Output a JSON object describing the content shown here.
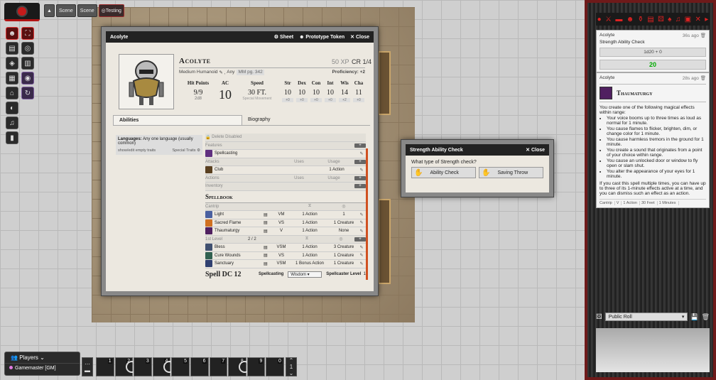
{
  "scene_nav": {
    "collapse_icon": "caret-up-icon",
    "scenes": [
      "Scene",
      "Scene",
      "Testing"
    ]
  },
  "tools": [
    "user-icon",
    "expand-icon",
    "ruler-icon",
    "target-icon",
    "shapes-icon",
    "tile-icon",
    "columns-icon",
    "eye-icon",
    "lightbulb-icon",
    "music-icon",
    "bookmark-icon"
  ],
  "sheet": {
    "title": "Acolyte",
    "header_buttons": [
      "Sheet",
      "Prototype Token",
      "Close"
    ],
    "name": "Acolyte",
    "xp": "50 XP",
    "cr": "CR 1/4",
    "type": "Medium Humanoid",
    "alignment": "Any",
    "source": "MM pg. 342",
    "proficiency_label": "Proficiency:",
    "proficiency": "+2",
    "hp_label": "Hit Points",
    "hp": "9/9",
    "hit_dice": "2d8",
    "ac_label": "AC",
    "ac": "10",
    "speed_label": "Speed",
    "speed": "30 FT.",
    "special_movement": "Special Movement",
    "abilities": [
      {
        "label": "Str",
        "value": "10",
        "mod": "+0"
      },
      {
        "label": "Dex",
        "value": "10",
        "mod": "+0"
      },
      {
        "label": "Con",
        "value": "10",
        "mod": "+0"
      },
      {
        "label": "Int",
        "value": "10",
        "mod": "+0"
      },
      {
        "label": "Wis",
        "value": "14",
        "mod": "+2"
      },
      {
        "label": "Cha",
        "value": "11",
        "mod": "+0"
      }
    ],
    "tabs": [
      "Abilities",
      "Biography"
    ],
    "languages_label": "Languages:",
    "languages": "Any one language (usually common)",
    "show_traits": "show/edit empty traits",
    "special_traits": "Special Traits",
    "delete_disabled": "Delete Disabled",
    "features": "Features",
    "spellcasting_item": "Spellcasting",
    "attacks": "Attacks",
    "uses": "Uses",
    "usage": "Usage",
    "club": "Club",
    "club_usage": "1 Action",
    "actions": "Actions",
    "inventory": "Inventory",
    "spellbook": "Spellbook",
    "cantrip": "Cantrip",
    "cantrips": [
      {
        "name": "Light",
        "comp": "VM",
        "time": "1 Action",
        "target": "1",
        "color": "#4a60a0"
      },
      {
        "name": "Sacred Flame",
        "comp": "VS",
        "time": "1 Action",
        "target": "1 Creature",
        "color": "#d07020"
      },
      {
        "name": "Thaumaturgy",
        "comp": "V",
        "time": "1 Action",
        "target": "None",
        "color": "#502060"
      }
    ],
    "level1_label": "1st Level",
    "level1_slots": "2 / 2",
    "level1": [
      {
        "name": "Bless",
        "comp": "VSM",
        "time": "1 Action",
        "target": "3 Creature",
        "color": "#405070"
      },
      {
        "name": "Cure Wounds",
        "comp": "VS",
        "time": "1 Action",
        "target": "1 Creature",
        "color": "#306050"
      },
      {
        "name": "Sanctuary",
        "comp": "VSM",
        "time": "1 Bonus Action",
        "target": "1 Creature",
        "color": "#304070"
      }
    ],
    "spell_dc": "Spell DC 12",
    "spellcasting_label": "Spellcasting",
    "spellcasting_value": "Wisdom",
    "caster_level_label": "Spellcaster Level",
    "caster_level": "1"
  },
  "check_dialog": {
    "title": "Strength Ability Check",
    "close": "Close",
    "question": "What type of Strength check?",
    "ability": "Ability Check",
    "save": "Saving Throw"
  },
  "sidebar": {
    "tab_icons": [
      "chat-icon",
      "combat-icon",
      "scenes-icon",
      "actors-icon",
      "items-icon",
      "journal-icon",
      "tables-icon",
      "cards-icon",
      "playlists-icon",
      "compendium-icon",
      "settings-icon",
      "collapse-icon"
    ],
    "msg1": {
      "speaker": "Acolyte",
      "time": "36s ago",
      "flavor": "Strength Ability Check",
      "formula": "1d20 + 0",
      "total": "20"
    },
    "msg2": {
      "speaker": "Acolyte",
      "time": "28s ago",
      "spell": "Thaumaturgy",
      "intro": "You create one of the following magical effects within range:",
      "bullets": [
        "Your voice booms up to three times as loud as normal for 1 minute.",
        "You cause flames to flicker, brighten, dim, or change color for 1 minute.",
        "You cause harmless tremors in the ground for 1 minute.",
        "You create a sound that originates from a point of your choice within range.",
        "You cause an unlocked door or window to fly open or slam shut.",
        "You alter the appearance of your eyes for 1 minute."
      ],
      "outro": "If you cast this spell multiple times, you can have up to three of its 1-minute effects active at a time, and you can dismiss such an effect as an action.",
      "tags": [
        "Cantrip",
        "V",
        "1 Action",
        "30 Feet",
        "1 Minutes"
      ]
    },
    "roll_mode": "Public Roll"
  },
  "players": {
    "title": "Players",
    "user": "Gamemaster [GM]"
  },
  "hotbar": {
    "slots": [
      "1",
      "2",
      "3",
      "4",
      "5",
      "6",
      "7",
      "8",
      "9",
      "0"
    ],
    "page": "1"
  }
}
